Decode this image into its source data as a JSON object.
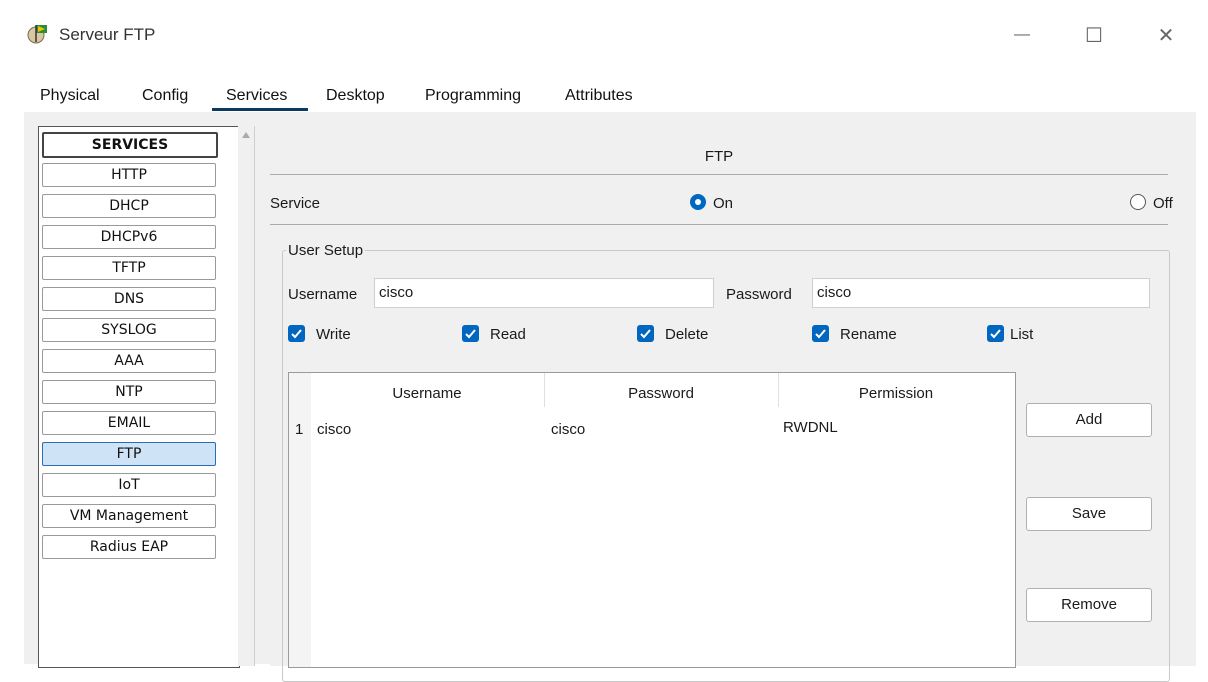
{
  "window": {
    "title": "Serveur FTP",
    "minimize_glyph": "—",
    "maximize_glyph": "☐",
    "close_glyph": "✕",
    "app_icon": "packet-tracer-server-icon"
  },
  "tabs": [
    {
      "label": "Physical"
    },
    {
      "label": "Config"
    },
    {
      "label": "Services"
    },
    {
      "label": "Desktop"
    },
    {
      "label": "Programming"
    },
    {
      "label": "Attributes"
    }
  ],
  "active_tab": "Services",
  "services": {
    "header": "SERVICES",
    "items": [
      {
        "label": "HTTP"
      },
      {
        "label": "DHCP"
      },
      {
        "label": "DHCPv6"
      },
      {
        "label": "TFTP"
      },
      {
        "label": "DNS"
      },
      {
        "label": "SYSLOG"
      },
      {
        "label": "AAA"
      },
      {
        "label": "NTP"
      },
      {
        "label": "EMAIL"
      },
      {
        "label": "FTP"
      },
      {
        "label": "IoT"
      },
      {
        "label": "VM Management"
      },
      {
        "label": "Radius EAP"
      }
    ],
    "selected": "FTP"
  },
  "ftp": {
    "title": "FTP",
    "service_label": "Service",
    "on_label": "On",
    "off_label": "Off",
    "service_state": "On",
    "user_setup_label": "User Setup",
    "username_label": "Username",
    "username_value": "cisco",
    "password_label": "Password",
    "password_value": "cisco",
    "permissions": [
      {
        "label": "Write",
        "checked": true
      },
      {
        "label": "Read",
        "checked": true
      },
      {
        "label": "Delete",
        "checked": true
      },
      {
        "label": "Rename",
        "checked": true
      },
      {
        "label": "List",
        "checked": true
      }
    ],
    "table": {
      "columns": [
        "Username",
        "Password",
        "Permission"
      ],
      "rows": [
        {
          "index": "1",
          "username": "cisco",
          "password": "cisco",
          "permission": "RWDNL"
        }
      ]
    },
    "buttons": {
      "add": "Add",
      "save": "Save",
      "remove": "Remove"
    }
  },
  "colors": {
    "accent": "#0067c0",
    "selected_bg": "#cfe3f7",
    "panel_bg": "#f0f0f0",
    "tab_underline": "#0b3a5e"
  }
}
